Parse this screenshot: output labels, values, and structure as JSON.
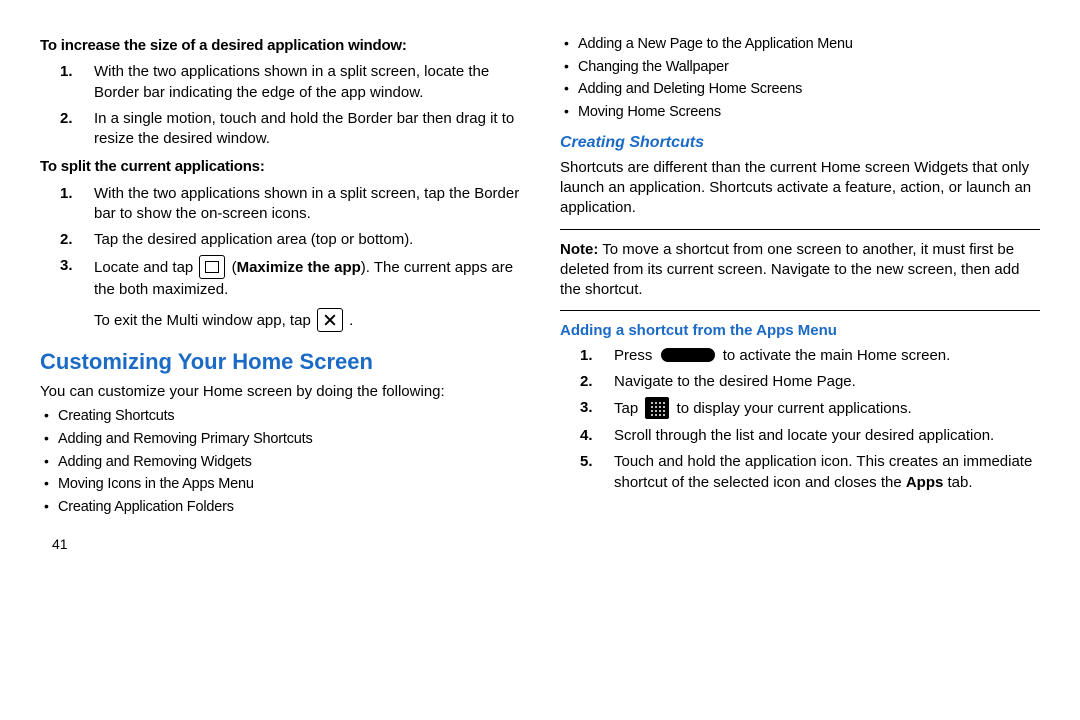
{
  "left": {
    "h_increase": "To increase the size of a desired application window:",
    "increase_steps": [
      "With the two applications shown in a split screen, locate the Border bar indicating the edge of the app window.",
      "In a single motion, touch and hold the Border bar then drag it to resize the desired window."
    ],
    "h_split": "To split the current applications:",
    "split_steps": [
      "With the two applications shown in a split screen, tap the Border bar to show the on-screen icons.",
      "Tap the desired application area (top or bottom)."
    ],
    "split_step3_a": "Locate and tap ",
    "split_step3_b": " (",
    "split_step3_bold": "Maximize the app",
    "split_step3_c": "). The current apps are the both maximized.",
    "exit_text_a": "To exit the Multi window app, tap ",
    "exit_text_b": " .",
    "section_title": "Customizing Your Home Screen",
    "customize_intro": "You can customize your Home screen by doing the following:",
    "customize_list": [
      "Creating Shortcuts",
      "Adding and Removing Primary Shortcuts",
      "Adding and Removing Widgets",
      "Moving Icons in the Apps Menu",
      "Creating Application Folders"
    ],
    "page_number": "41"
  },
  "right": {
    "top_list": [
      "Adding a New Page to the Application Menu",
      "Changing the Wallpaper",
      "Adding and Deleting Home Screens",
      "Moving Home Screens"
    ],
    "creating_shortcuts_h": "Creating Shortcuts",
    "creating_shortcuts_p": "Shortcuts are different than the current Home screen Widgets that only launch an application. Shortcuts activate a feature, action, or launch an application.",
    "note_label": "Note:",
    "note_body": " To move a shortcut from one screen to another, it must first be deleted from its current screen. Navigate to the new screen, then add the shortcut.",
    "adding_shortcut_h": "Adding a shortcut from the Apps Menu",
    "steps": {
      "s1a": "Press ",
      "s1b": " to activate the main Home screen.",
      "s2": "Navigate to the desired Home Page.",
      "s3a": "Tap ",
      "s3b": " to display your current applications.",
      "s4": "Scroll through the list and locate your desired application.",
      "s5a": "Touch and hold the application icon. This creates an immediate shortcut of the selected icon and closes the ",
      "s5bold": "Apps",
      "s5b": " tab."
    }
  }
}
